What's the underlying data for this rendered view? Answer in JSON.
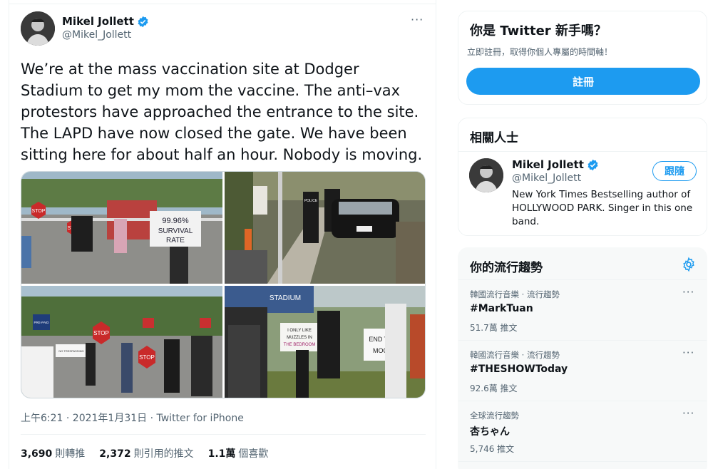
{
  "tweet": {
    "author_name": "Mikel Jollett",
    "author_handle": "@Mikel_Jollett",
    "more_label": "···",
    "text": "We’re at the mass vaccination site at Dodger Stadium to get my mom the vaccine. The anti–vax protestors have approached the entrance to the site. The LAPD have now closed the gate. We have been sitting here for about half an hour. Nobody is moving.",
    "timestamp": "上午6:21 · 2021年1月31日 · Twitter for iPhone",
    "stats": [
      {
        "value": "3,690",
        "label": "則轉推"
      },
      {
        "value": "2,372",
        "label": "則引用的推文"
      },
      {
        "value": "1.1萬",
        "label": "個喜歡"
      }
    ],
    "photos": {
      "p1_signs": [
        "STOP",
        "99.96%",
        "SURVIVAL",
        "RATE"
      ],
      "p2_signs": [
        "POLICE"
      ],
      "p3_signs": [
        "STOP",
        "STOP",
        "PRE-PAID",
        "NO TRESPASSING"
      ],
      "p4_signs": [
        "STADIUM",
        "I ONLY LIKE MUZZLES IN THE BEDROOM",
        "END THE MOON"
      ]
    }
  },
  "signup": {
    "title": "你是 Twitter 新手嗎？",
    "subtitle": "立即註冊，取得你個人專屬的時間軸！",
    "button": "註冊"
  },
  "related": {
    "title": "相關人士",
    "name": "Mikel Jollett",
    "handle": "@Mikel_Jollett",
    "follow": "跟隨",
    "bio": "New York Times Bestselling author of HOLLYWOOD PARK. Singer in this one band."
  },
  "trends": {
    "title": "你的流行趨勢",
    "items": [
      {
        "category": "韓國流行音樂 · 流行趨勢",
        "name": "#MarkTuan",
        "count": "51.7萬 推文"
      },
      {
        "category": "韓國流行音樂 · 流行趨勢",
        "name": "#THESHOWToday",
        "count": "92.6萬 推文"
      },
      {
        "category": "全球流行趨勢",
        "name": "杏ちゃん",
        "count": "5,746 推文"
      }
    ],
    "more_label": "···"
  },
  "colors": {
    "accent": "#1d9bf0",
    "secondary_text": "#536471",
    "border": "#eff3f4"
  }
}
